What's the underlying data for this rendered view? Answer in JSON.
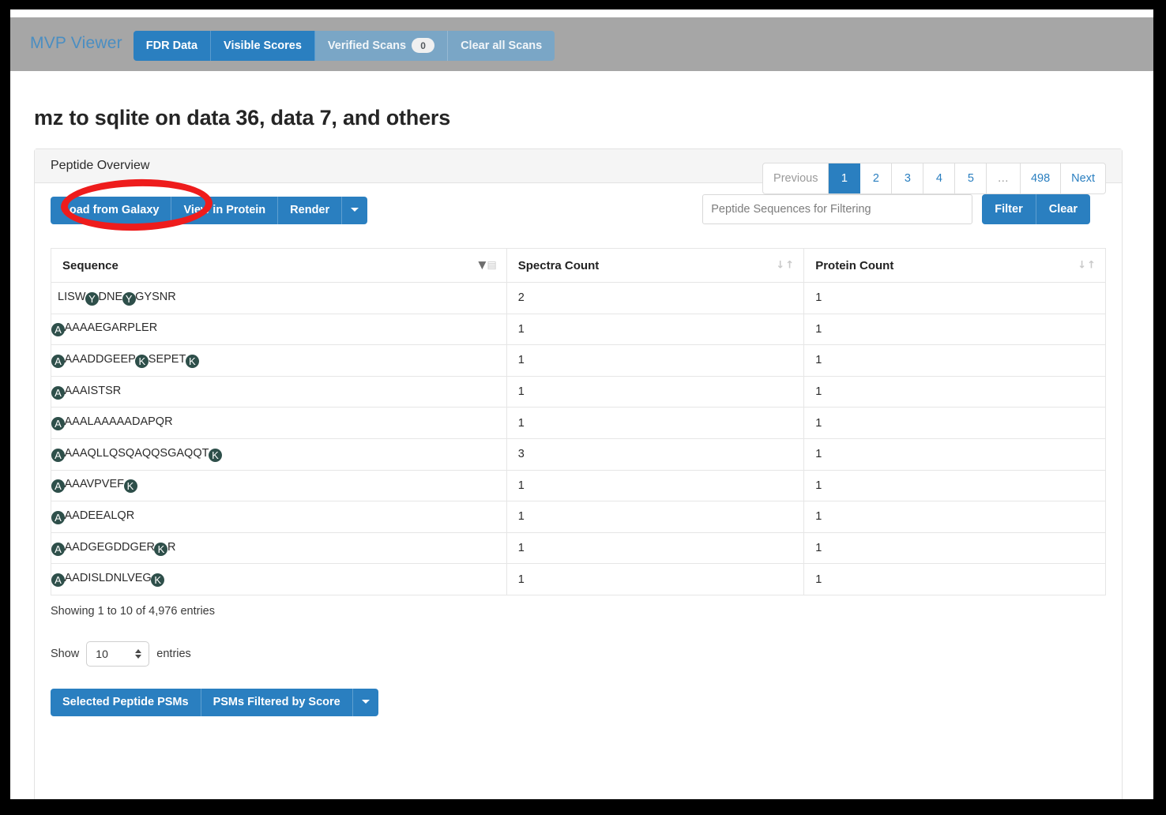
{
  "navbar": {
    "brand": "MVP Viewer",
    "items": [
      {
        "label": "FDR Data",
        "style": "primary"
      },
      {
        "label": "Visible Scores",
        "style": "primary"
      },
      {
        "label": "Verified Scans",
        "style": "muted",
        "badge": "0"
      },
      {
        "label": "Clear all Scans",
        "style": "muted"
      }
    ]
  },
  "page": {
    "title": "mz to sqlite on data 36, data 7, and others"
  },
  "panel": {
    "title": "Peptide Overview",
    "toolbar": {
      "load_from_galaxy": "Load from Galaxy",
      "view_in_protein": "View in Protein",
      "render": "Render"
    },
    "filter": {
      "placeholder": "Peptide Sequences for Filtering",
      "value": "",
      "filter_label": "Filter",
      "clear_label": "Clear"
    },
    "table": {
      "columns": [
        {
          "label": "Sequence",
          "sort": "desc"
        },
        {
          "label": "Spectra Count",
          "sort": "none"
        },
        {
          "label": "Protein Count",
          "sort": "none"
        }
      ],
      "rows": [
        {
          "sequence": "LISWYDNEYGYSNR",
          "highlight": [
            4,
            8
          ],
          "clip_first": false,
          "spectra_count": "2",
          "protein_count": "1"
        },
        {
          "sequence": "AAAAAEGARPLER",
          "highlight": [
            0
          ],
          "clip_first": true,
          "spectra_count": "1",
          "protein_count": "1"
        },
        {
          "sequence": "AAAADDGEEPKSEPETK",
          "highlight": [
            0,
            10,
            16
          ],
          "clip_first": true,
          "spectra_count": "1",
          "protein_count": "1"
        },
        {
          "sequence": "AAAAISTSR",
          "highlight": [
            0
          ],
          "clip_first": true,
          "spectra_count": "1",
          "protein_count": "1"
        },
        {
          "sequence": "AAAALAAAAADAPQR",
          "highlight": [
            0
          ],
          "clip_first": true,
          "spectra_count": "1",
          "protein_count": "1"
        },
        {
          "sequence": "AAAAQLLQSQAQQSGAQQTK",
          "highlight": [
            0,
            19
          ],
          "clip_first": true,
          "spectra_count": "3",
          "protein_count": "1"
        },
        {
          "sequence": "AAAAVPVEFK",
          "highlight": [
            0,
            9
          ],
          "clip_first": true,
          "spectra_count": "1",
          "protein_count": "1"
        },
        {
          "sequence": "AAADEEALQR",
          "highlight": [
            0
          ],
          "clip_first": true,
          "spectra_count": "1",
          "protein_count": "1"
        },
        {
          "sequence": "AAADGEGDDGERKR",
          "highlight": [
            0,
            12
          ],
          "clip_first": true,
          "spectra_count": "1",
          "protein_count": "1"
        },
        {
          "sequence": "AAADISLDNLVEGK",
          "highlight": [
            0,
            13
          ],
          "clip_first": true,
          "spectra_count": "1",
          "protein_count": "1"
        }
      ],
      "info": "Showing 1 to 10 of 4,976 entries"
    },
    "paging": [
      {
        "label": "Previous",
        "state": "disabled"
      },
      {
        "label": "1",
        "state": "active"
      },
      {
        "label": "2",
        "state": "normal"
      },
      {
        "label": "3",
        "state": "normal"
      },
      {
        "label": "4",
        "state": "normal"
      },
      {
        "label": "5",
        "state": "normal"
      },
      {
        "label": "…",
        "state": "ellipsis"
      },
      {
        "label": "498",
        "state": "normal"
      },
      {
        "label": "Next",
        "state": "normal"
      }
    ],
    "length_menu": {
      "prefix": "Show",
      "value": "10",
      "suffix": "entries"
    },
    "bottom_actions": {
      "selected_peptide_psms": "Selected Peptide PSMs",
      "psms_filtered_by_score": "PSMs Filtered by Score"
    }
  },
  "colors": {
    "accent_blue": "#2a7fc0",
    "muted_blue": "#7aa6c6",
    "navbar_gray": "#a6a6a6",
    "residue_highlight": "#2e4f4a",
    "annotation_red": "#ee1c1c"
  }
}
